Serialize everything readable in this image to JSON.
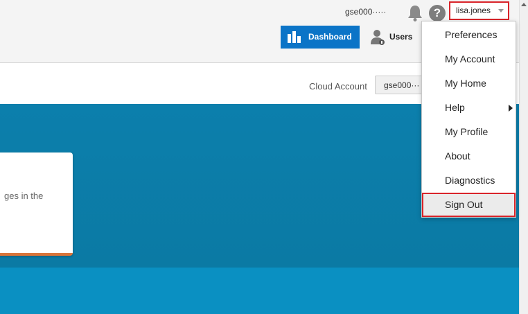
{
  "header": {
    "account_id": "gse000·····",
    "username": "lisa.jones",
    "help_glyph": "?",
    "tabs": [
      {
        "label": "Dashboard",
        "icon": "bar-chart-icon",
        "active": true
      },
      {
        "label": "Users",
        "icon": "user-icon",
        "active": false
      }
    ]
  },
  "sub_header": {
    "cloud_account_label": "Cloud Account",
    "cloud_account_value": "gse000···"
  },
  "hero": {
    "card_text": "ges in the"
  },
  "user_menu": {
    "items": [
      {
        "label": "Preferences"
      },
      {
        "label": "My Account"
      },
      {
        "label": "My Home"
      },
      {
        "label": "Help",
        "submenu": true
      },
      {
        "label": "My Profile"
      },
      {
        "label": "About"
      },
      {
        "label": "Diagnostics"
      },
      {
        "label": "Sign Out",
        "highlighted": true
      }
    ]
  },
  "colors": {
    "brand_blue": "#0b74c7",
    "hero_teal": "#0c7fac",
    "highlight_red": "#d9242a",
    "card_accent": "#d9753a"
  }
}
